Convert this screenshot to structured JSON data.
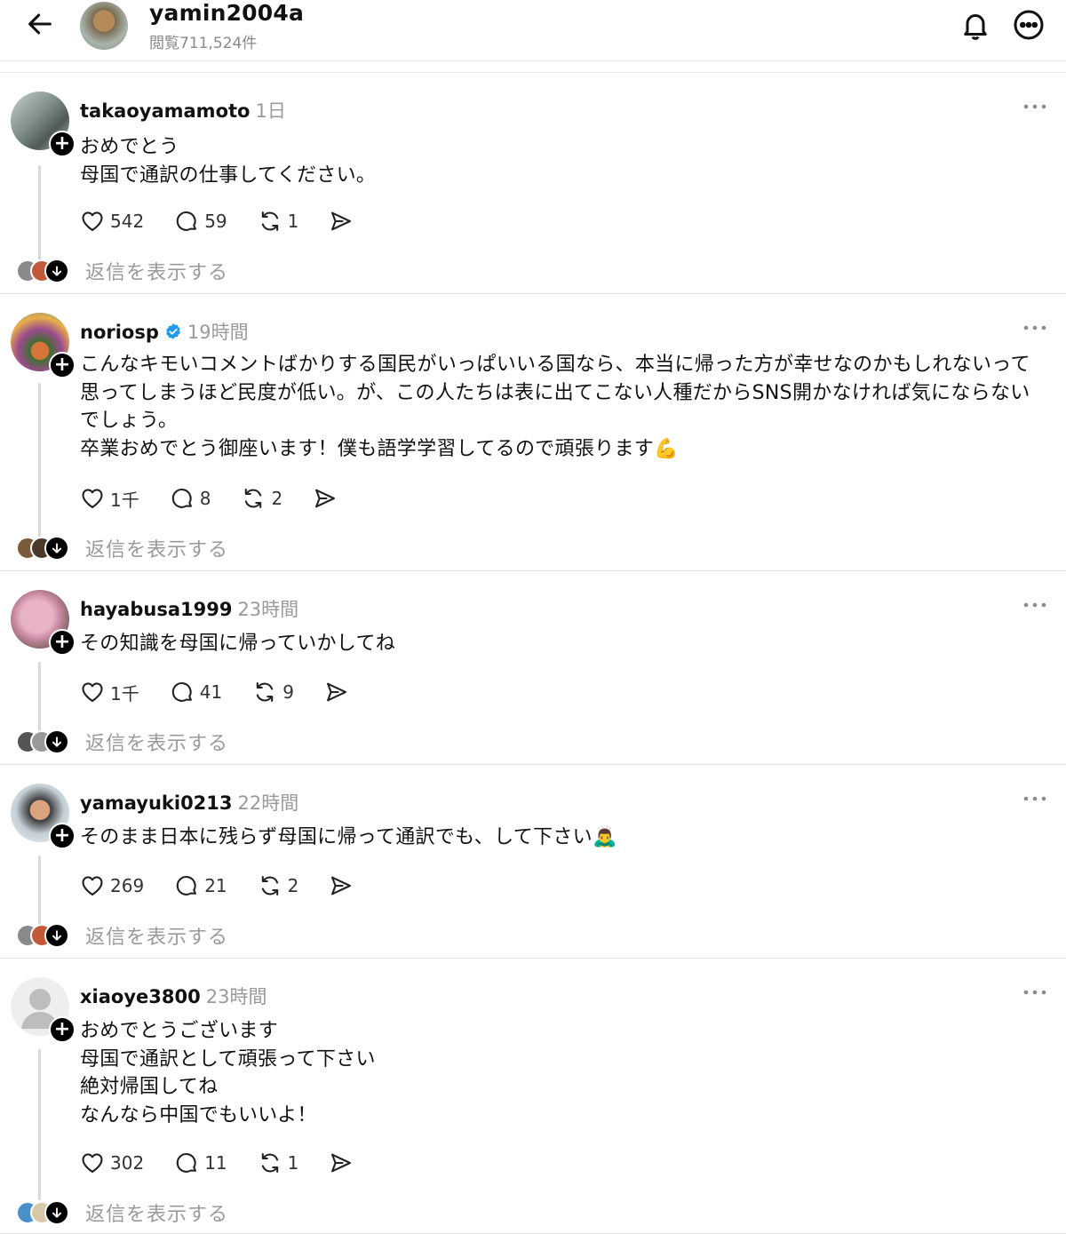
{
  "header": {
    "username": "yamin2004a",
    "views": "閲覧711,524件"
  },
  "show_replies_label": "返信を表示する",
  "posts": [
    {
      "user": "takaoyamamoto",
      "time": "1日",
      "verified": false,
      "text": "おめでとう\n母国で通訳の仕事してください。",
      "likes": "542",
      "comments": "59",
      "reposts": "1"
    },
    {
      "user": "noriosp",
      "time": "19時間",
      "verified": true,
      "text": "こんなキモいコメントばかりする国民がいっぱいいる国なら、本当に帰った方が幸せなのかもしれないって思ってしまうほど民度が低い。が、この人たちは表に出てこない人種だからSNS開かなければ気にならないでしょう。\n卒業おめでとう御座います！僕も語学学習してるので頑張ります💪",
      "likes": "1千",
      "comments": "8",
      "reposts": "2"
    },
    {
      "user": "hayabusa1999",
      "time": "23時間",
      "verified": false,
      "text": "その知識を母国に帰っていかしてね",
      "likes": "1千",
      "comments": "41",
      "reposts": "9"
    },
    {
      "user": "yamayuki0213",
      "time": "22時間",
      "verified": false,
      "text": "そのまま日本に残らず母国に帰って通訳でも、して下さい🙇‍♂️",
      "likes": "269",
      "comments": "21",
      "reposts": "2"
    },
    {
      "user": "xiaoye3800",
      "time": "23時間",
      "verified": false,
      "text": "おめでとうございます\n母国で通訳として頑張って下さい\n絶対帰国してね\nなんなら中国でもいいよ！",
      "likes": "302",
      "comments": "11",
      "reposts": "1"
    }
  ],
  "colors": {
    "muted": "#9a9a9a",
    "verified": "#1d9bf0",
    "line": "#d9d9d9"
  },
  "icons": [
    "back-arrow-icon",
    "bell-icon",
    "more-circle-icon",
    "heart-icon",
    "comment-icon",
    "repost-icon",
    "share-icon",
    "more-dots-icon",
    "verified-badge-icon",
    "plus-icon",
    "arrow-down-icon"
  ]
}
